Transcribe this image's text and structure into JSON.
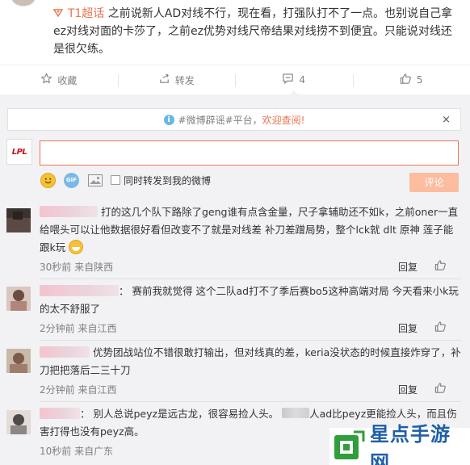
{
  "post": {
    "topic_tag": "T1超话",
    "text": " 之前说新人AD对线不行，现在看，打强队打不了一点。也别说自己拿ez对线对面的卡莎了，之前ez优势对线尺帝结果对线捞不到便宜。只能说对线还是很欠练。"
  },
  "actions": {
    "favorite_label": "收藏",
    "repost_label": "转发",
    "comment_count": "4",
    "like_count": "5"
  },
  "notice": {
    "prefix": "#微博辟谣#平台，",
    "highlight": "欢迎查阅!",
    "close": "×"
  },
  "composer": {
    "lpl_logo": "LPL",
    "gif_label": "GIF",
    "sync_repost_label": "同时转发到我的微博",
    "submit_label": "评论"
  },
  "comments": [
    {
      "text_after_name": "打的这几个队下路除了geng谁有点含金量，尺子拿辅助还不如k，之前oner一直给喂头可以让他数据很好看但改变不了就是对线差 补刀差蹭局势，整个lck就 dlt 原神 莲子能跟k玩",
      "time": "30秒前",
      "location": "来自陕西",
      "reply_label": "回复"
    },
    {
      "text_after_name": "赛前我就觉得 这个二队ad打不了季后赛bo5这种高端对局 今天看来小k玩的太不舒服了",
      "time": "2分钟前",
      "location": "来自江西",
      "reply_label": "回复"
    },
    {
      "text_after_name": "优势团战站位不错很敢打输出，但对线真的差，keria没状态的时候直接炸穿了，补刀把把落后二三十刀",
      "time": "2分钟前",
      "location": "来自江西",
      "reply_label": "回复"
    },
    {
      "text_after_name": "别人总说peyz是远古龙，很容易捡人头。",
      "text_after_blur": "人ad比peyz更能捡人头，而且伤害打得也没有peyz高。",
      "time": "10秒前",
      "location": "来自广东",
      "reply_label": "回复"
    }
  ],
  "watermark": {
    "text": "星点手游网"
  },
  "colors": {
    "accent": "#eb7350",
    "link_blue": "#66b8e8",
    "comment_bg": "#f2f2f5",
    "watermark_blue": "#1f5fa6",
    "watermark_green": "#2f9e3c"
  }
}
